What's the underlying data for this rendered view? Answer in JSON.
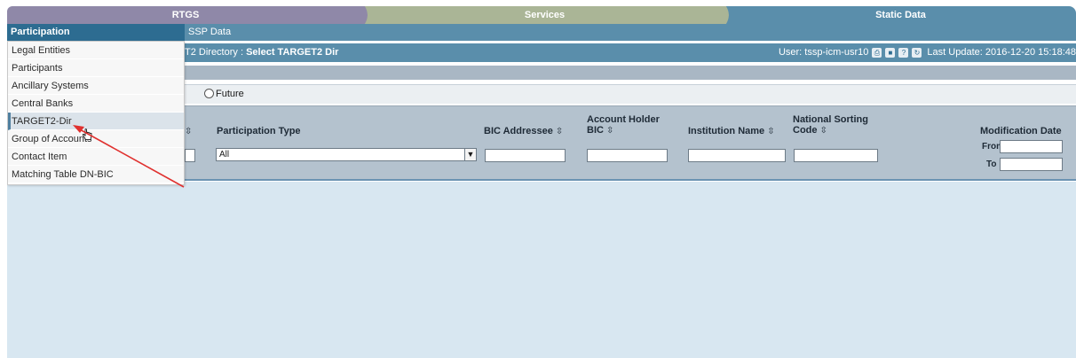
{
  "tabs": [
    {
      "label": "RTGS"
    },
    {
      "label": "Services"
    },
    {
      "label": "Static Data"
    }
  ],
  "nav": {
    "participation": "Participation",
    "ssp_data": "SSP Data"
  },
  "breadcrumb": {
    "prefix": "T2 Directory  :  ",
    "current": "Select TARGET2 Dir",
    "user": "User: tssp-icm-usr10",
    "last_update": "Last Update: 2016-12-20 15:18:48"
  },
  "options": {
    "future_label": "Future"
  },
  "columns": {
    "participation_type": "Participation Type",
    "bic_addressee": "BIC Addressee",
    "account_holder_bic_1": "Account Holder",
    "account_holder_bic_2": "BIC",
    "institution_name": "Institution Name",
    "national_sorting_1": "National Sorting",
    "national_sorting_2": "Code",
    "modification_date": "Modification Date",
    "from_label": "From",
    "to_label": "To",
    "participation_type_selected": "All",
    "sort_glyph": "⇳"
  },
  "menu": {
    "items": [
      {
        "label": "Legal Entities"
      },
      {
        "label": "Participants"
      },
      {
        "label": "Ancillary Systems"
      },
      {
        "label": "Central Banks"
      },
      {
        "label": "TARGET2-Dir"
      },
      {
        "label": "Group of Accounts"
      },
      {
        "label": "Contact Item"
      },
      {
        "label": "Matching Table DN-BIC"
      }
    ],
    "active_index": 4
  },
  "colors": {
    "tab_rtgs": "#8f88a8",
    "tab_services": "#aab596",
    "tab_static": "#5a8eab",
    "nav_dark": "#2d6c91",
    "annotation_arrow": "#e0312f"
  }
}
